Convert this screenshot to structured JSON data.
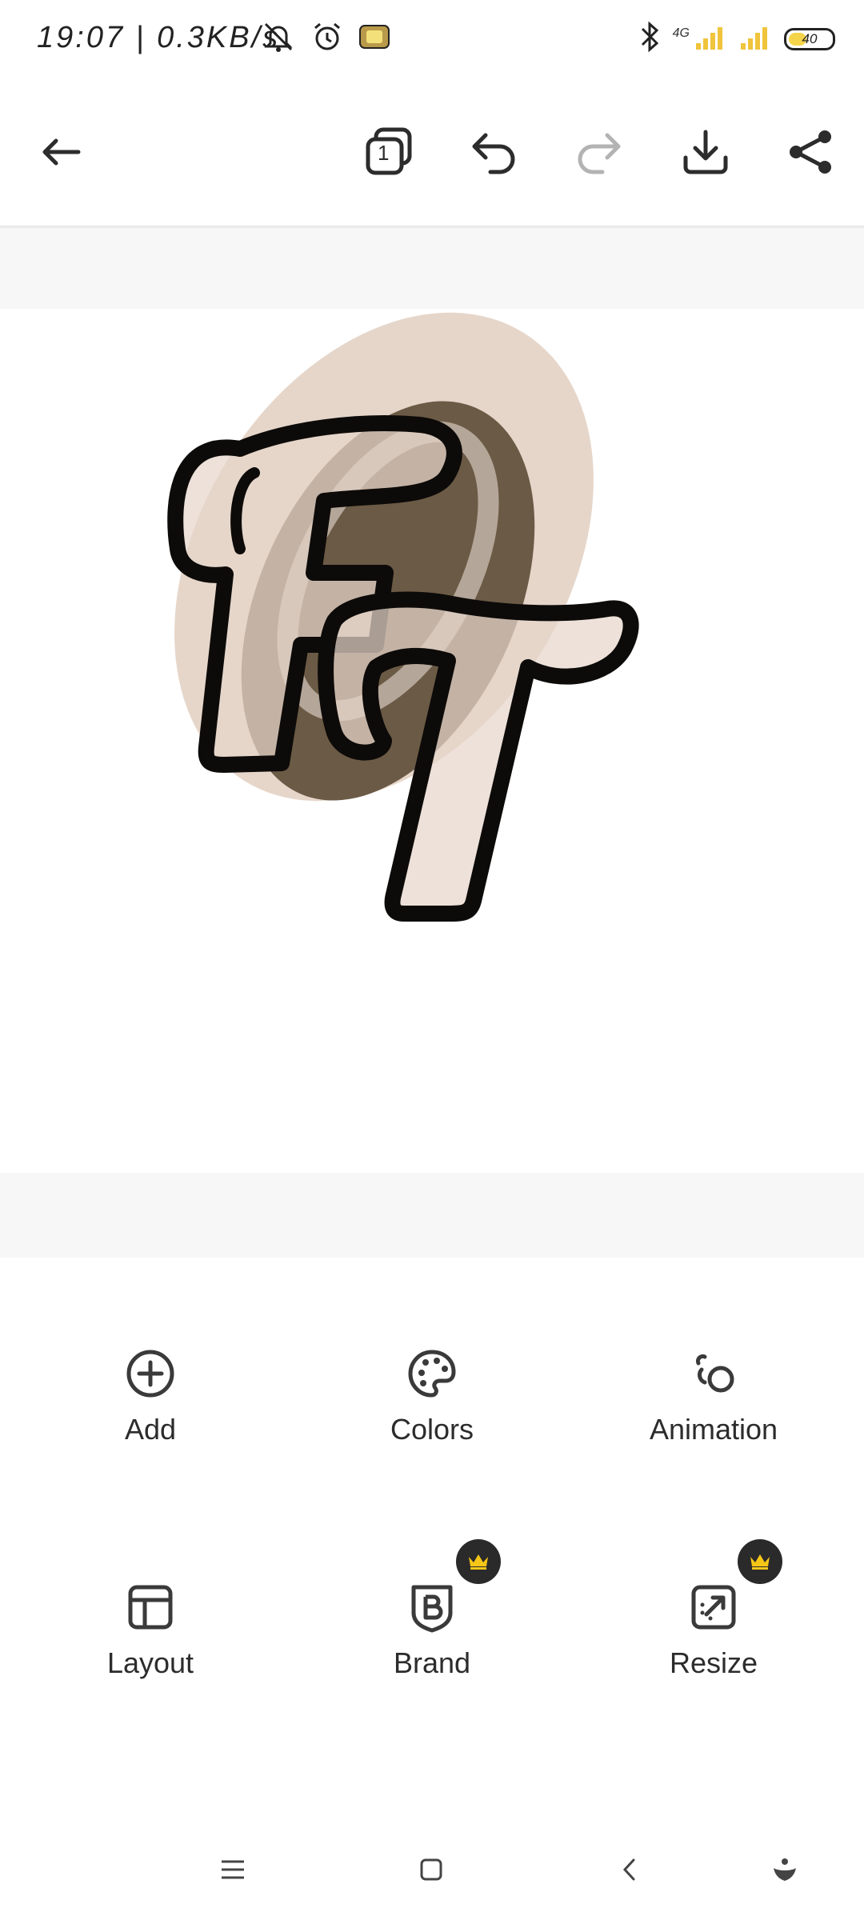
{
  "status_bar": {
    "time": "19:07 | 0.3KB/s",
    "network_label": "4G",
    "battery": "40"
  },
  "toolbar": {
    "pages_count": "1",
    "icons": [
      "back-arrow-icon",
      "pages-icon",
      "undo-icon",
      "redo-icon",
      "download-icon",
      "share-icon"
    ]
  },
  "design": {
    "monogram": "FT",
    "colors": {
      "light_beige": "#e6d6ca",
      "dark_brown": "#6b5a45",
      "outline": "#0d0b09"
    }
  },
  "tools": {
    "items": [
      {
        "label": "Add",
        "icon": "plus-circle-icon",
        "premium": false
      },
      {
        "label": "Colors",
        "icon": "palette-icon",
        "premium": false
      },
      {
        "label": "Animation",
        "icon": "animation-icon",
        "premium": false
      },
      {
        "label": "Layout",
        "icon": "layout-icon",
        "premium": false
      },
      {
        "label": "Brand",
        "icon": "brand-icon",
        "premium": true
      },
      {
        "label": "Resize",
        "icon": "resize-icon",
        "premium": true
      }
    ],
    "crown_color": "#f5c518"
  },
  "navbar": {
    "icons": [
      "menu-icon",
      "home-square-icon",
      "back-chevron-icon",
      "assistant-icon"
    ]
  }
}
